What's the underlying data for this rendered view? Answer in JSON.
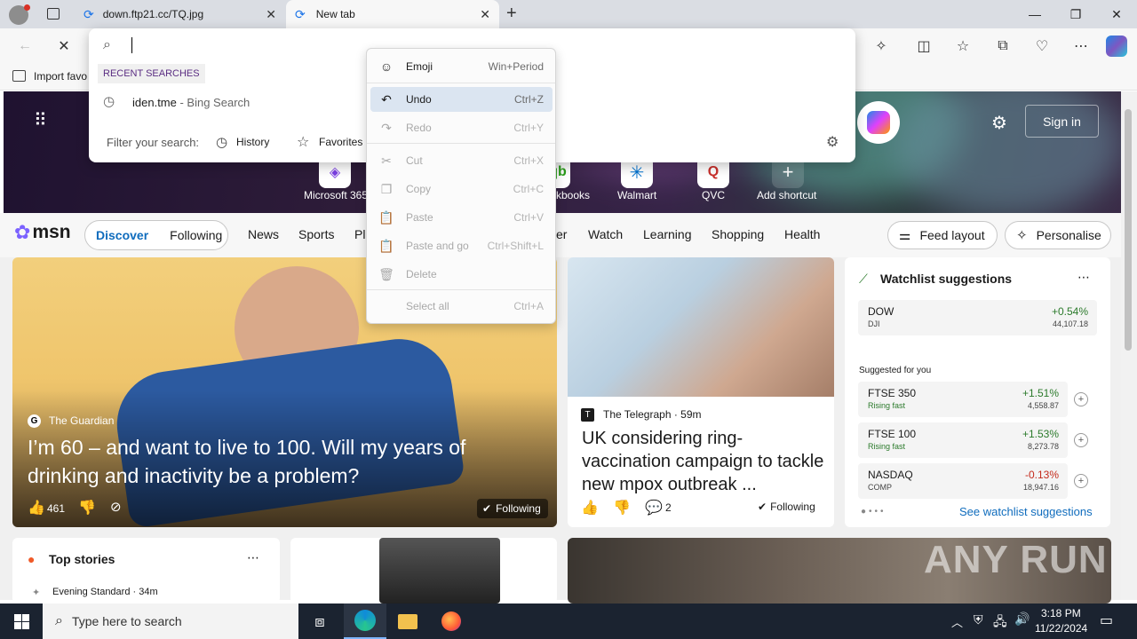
{
  "browser": {
    "tabs": [
      {
        "title": "down.ftp21.cc/TQ.jpg"
      },
      {
        "title": "New tab"
      }
    ],
    "favorites_bar_label": "Import favo"
  },
  "address_dropdown": {
    "recent_header": "RECENT SEARCHES",
    "recent_item_query": "iden.tme",
    "recent_item_source": " - Bing Search",
    "filter_label": "Filter your search:",
    "filter_history": "History",
    "filter_favorites": "Favorites"
  },
  "context_menu": {
    "items": [
      {
        "label": "Emoji",
        "shortcut": "Win+Period",
        "icon": "☺"
      },
      {
        "label": "Undo",
        "shortcut": "Ctrl+Z",
        "icon": "↶"
      },
      {
        "label": "Redo",
        "shortcut": "Ctrl+Y",
        "icon": "↷"
      },
      {
        "label": "Cut",
        "shortcut": "Ctrl+X",
        "icon": "✂"
      },
      {
        "label": "Copy",
        "shortcut": "Ctrl+C",
        "icon": "❐"
      },
      {
        "label": "Paste",
        "shortcut": "Ctrl+V",
        "icon": "📋"
      },
      {
        "label": "Paste and go",
        "shortcut": "Ctrl+Shift+L",
        "icon": "📋"
      },
      {
        "label": "Delete",
        "shortcut": "",
        "icon": "🗑"
      },
      {
        "label": "Select all",
        "shortcut": "Ctrl+A",
        "icon": ""
      }
    ]
  },
  "hero": {
    "shortcuts": [
      {
        "label": "Microsoft 365"
      },
      {
        "label": "kbooks"
      },
      {
        "label": "Walmart"
      },
      {
        "label": "QVC"
      },
      {
        "label": "Add shortcut"
      }
    ],
    "sign_in": "Sign in"
  },
  "msn": {
    "logo": "msn",
    "tabs": [
      "Discover",
      "Following"
    ],
    "nav": [
      "News",
      "Sports",
      "Pl",
      "er",
      "Watch",
      "Learning",
      "Shopping",
      "Health"
    ],
    "feed_layout": "Feed layout",
    "personalise": "Personalise"
  },
  "main_story": {
    "source": "The Guardian",
    "headline": "I’m 60 – and want to live to 100. Will my years of drinking and inactivity be a problem?",
    "likes": "461",
    "following": "Following"
  },
  "side_story": {
    "source": "The Telegraph",
    "time": " · 59m",
    "headline": "UK considering ring-vaccination campaign to tackle new mpox outbreak ...",
    "comments": "2",
    "following": "Following"
  },
  "watchlist": {
    "title": "Watchlist suggestions",
    "main": {
      "name": "DOW",
      "sub": "DJI",
      "pct": "+0.54%",
      "value": "44,107.18"
    },
    "suggested_label": "Suggested for you",
    "suggested": [
      {
        "name": "FTSE 350",
        "sub": "Rising fast",
        "pct": "+1.51%",
        "value": "4,558.87"
      },
      {
        "name": "FTSE 100",
        "sub": "Rising fast",
        "pct": "+1.53%",
        "value": "8,273.78"
      },
      {
        "name": "NASDAQ",
        "sub": "COMP",
        "pct": "-0.13%",
        "value": "18,947.16"
      }
    ],
    "see_more": "See watchlist suggestions"
  },
  "top_stories": {
    "title": "Top stories",
    "first_source": "Evening Standard · 34m"
  },
  "taskbar": {
    "search_placeholder": "Type here to search",
    "time": "3:18 PM",
    "date": "11/22/2024"
  },
  "watermark": "ANY RUN"
}
